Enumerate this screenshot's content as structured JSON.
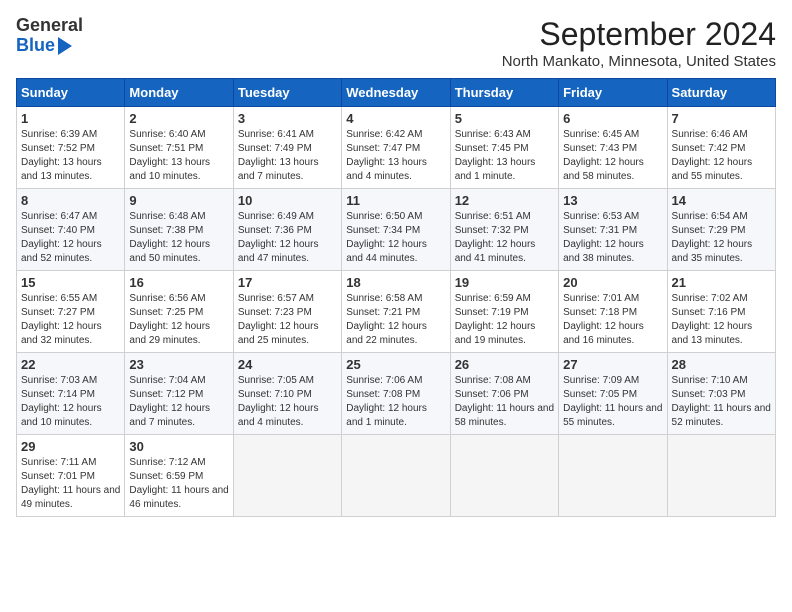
{
  "logo": {
    "general": "General",
    "blue": "Blue"
  },
  "title": "September 2024",
  "subtitle": "North Mankato, Minnesota, United States",
  "days": [
    "Sunday",
    "Monday",
    "Tuesday",
    "Wednesday",
    "Thursday",
    "Friday",
    "Saturday"
  ],
  "weeks": [
    [
      {
        "day": "1",
        "rise": "6:39 AM",
        "set": "7:52 PM",
        "daylight": "13 hours and 13 minutes."
      },
      {
        "day": "2",
        "rise": "6:40 AM",
        "set": "7:51 PM",
        "daylight": "13 hours and 10 minutes."
      },
      {
        "day": "3",
        "rise": "6:41 AM",
        "set": "7:49 PM",
        "daylight": "13 hours and 7 minutes."
      },
      {
        "day": "4",
        "rise": "6:42 AM",
        "set": "7:47 PM",
        "daylight": "13 hours and 4 minutes."
      },
      {
        "day": "5",
        "rise": "6:43 AM",
        "set": "7:45 PM",
        "daylight": "13 hours and 1 minute."
      },
      {
        "day": "6",
        "rise": "6:45 AM",
        "set": "7:43 PM",
        "daylight": "12 hours and 58 minutes."
      },
      {
        "day": "7",
        "rise": "6:46 AM",
        "set": "7:42 PM",
        "daylight": "12 hours and 55 minutes."
      }
    ],
    [
      {
        "day": "8",
        "rise": "6:47 AM",
        "set": "7:40 PM",
        "daylight": "12 hours and 52 minutes."
      },
      {
        "day": "9",
        "rise": "6:48 AM",
        "set": "7:38 PM",
        "daylight": "12 hours and 50 minutes."
      },
      {
        "day": "10",
        "rise": "6:49 AM",
        "set": "7:36 PM",
        "daylight": "12 hours and 47 minutes."
      },
      {
        "day": "11",
        "rise": "6:50 AM",
        "set": "7:34 PM",
        "daylight": "12 hours and 44 minutes."
      },
      {
        "day": "12",
        "rise": "6:51 AM",
        "set": "7:32 PM",
        "daylight": "12 hours and 41 minutes."
      },
      {
        "day": "13",
        "rise": "6:53 AM",
        "set": "7:31 PM",
        "daylight": "12 hours and 38 minutes."
      },
      {
        "day": "14",
        "rise": "6:54 AM",
        "set": "7:29 PM",
        "daylight": "12 hours and 35 minutes."
      }
    ],
    [
      {
        "day": "15",
        "rise": "6:55 AM",
        "set": "7:27 PM",
        "daylight": "12 hours and 32 minutes."
      },
      {
        "day": "16",
        "rise": "6:56 AM",
        "set": "7:25 PM",
        "daylight": "12 hours and 29 minutes."
      },
      {
        "day": "17",
        "rise": "6:57 AM",
        "set": "7:23 PM",
        "daylight": "12 hours and 25 minutes."
      },
      {
        "day": "18",
        "rise": "6:58 AM",
        "set": "7:21 PM",
        "daylight": "12 hours and 22 minutes."
      },
      {
        "day": "19",
        "rise": "6:59 AM",
        "set": "7:19 PM",
        "daylight": "12 hours and 19 minutes."
      },
      {
        "day": "20",
        "rise": "7:01 AM",
        "set": "7:18 PM",
        "daylight": "12 hours and 16 minutes."
      },
      {
        "day": "21",
        "rise": "7:02 AM",
        "set": "7:16 PM",
        "daylight": "12 hours and 13 minutes."
      }
    ],
    [
      {
        "day": "22",
        "rise": "7:03 AM",
        "set": "7:14 PM",
        "daylight": "12 hours and 10 minutes."
      },
      {
        "day": "23",
        "rise": "7:04 AM",
        "set": "7:12 PM",
        "daylight": "12 hours and 7 minutes."
      },
      {
        "day": "24",
        "rise": "7:05 AM",
        "set": "7:10 PM",
        "daylight": "12 hours and 4 minutes."
      },
      {
        "day": "25",
        "rise": "7:06 AM",
        "set": "7:08 PM",
        "daylight": "12 hours and 1 minute."
      },
      {
        "day": "26",
        "rise": "7:08 AM",
        "set": "7:06 PM",
        "daylight": "11 hours and 58 minutes."
      },
      {
        "day": "27",
        "rise": "7:09 AM",
        "set": "7:05 PM",
        "daylight": "11 hours and 55 minutes."
      },
      {
        "day": "28",
        "rise": "7:10 AM",
        "set": "7:03 PM",
        "daylight": "11 hours and 52 minutes."
      }
    ],
    [
      {
        "day": "29",
        "rise": "7:11 AM",
        "set": "7:01 PM",
        "daylight": "11 hours and 49 minutes."
      },
      {
        "day": "30",
        "rise": "7:12 AM",
        "set": "6:59 PM",
        "daylight": "11 hours and 46 minutes."
      },
      null,
      null,
      null,
      null,
      null
    ]
  ]
}
